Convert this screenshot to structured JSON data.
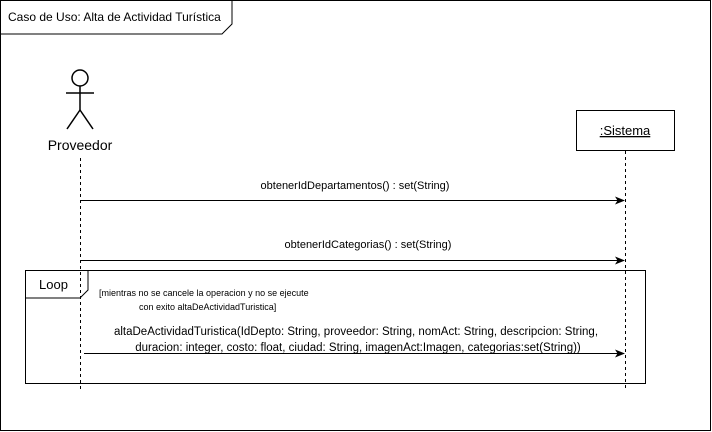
{
  "frame": {
    "title": "Caso de Uso: Alta de Actividad Turística"
  },
  "actor": {
    "label": "Proveedor"
  },
  "system": {
    "label": ":Sistema"
  },
  "messages": {
    "m1": "obtenerIdDepartamentos() : set(String)",
    "m2": "obtenerIdCategorias() : set(String)",
    "m3_line1": "altaDeActividadTuristica(IdDepto: String, proveedor: String, nomAct: String, descripcion: String,",
    "m3_line2": "duracion: integer, costo: float, ciudad: String, imagenAct:Imagen, categorias:set(String))"
  },
  "loop": {
    "label": "Loop",
    "guard_line1": "[mientras no se cancele la operacion y no se ejecute",
    "guard_line2": "con exito altaDeActividadTuristica]"
  },
  "colors": {
    "stroke": "#000000",
    "background": "#ffffff"
  }
}
